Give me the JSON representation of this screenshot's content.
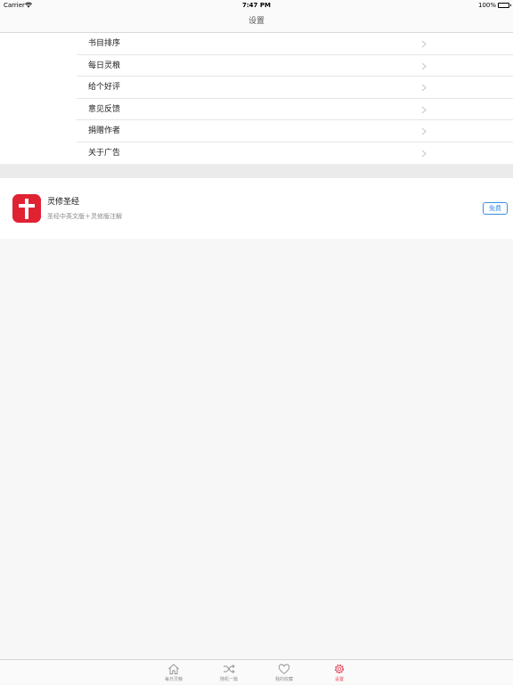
{
  "status_bar": {
    "carrier": "Carrier",
    "time": "7:47 PM",
    "battery": "100%"
  },
  "nav": {
    "title": "设置"
  },
  "settings": {
    "items": [
      {
        "label": "书目排序"
      },
      {
        "label": "每日灵粮"
      },
      {
        "label": "给个好评"
      },
      {
        "label": "意见反馈"
      },
      {
        "label": "捐赠作者"
      },
      {
        "label": "关于广告"
      }
    ]
  },
  "promo": {
    "app_name": "灵修圣经",
    "subtitle": "圣经中英文版＋灵修版注解",
    "price_label": "免费",
    "icon": "cross-icon",
    "icon_color": "#e02232"
  },
  "tabs": {
    "items": [
      {
        "label": "每日灵粮",
        "icon": "home-icon"
      },
      {
        "label": "随机一篇",
        "icon": "shuffle-icon"
      },
      {
        "label": "我的收藏",
        "icon": "heart-icon"
      },
      {
        "label": "设置",
        "icon": "gear-icon"
      }
    ],
    "active_index": 3,
    "active_color": "#e8455b",
    "inactive_color": "#8e8e8e"
  }
}
